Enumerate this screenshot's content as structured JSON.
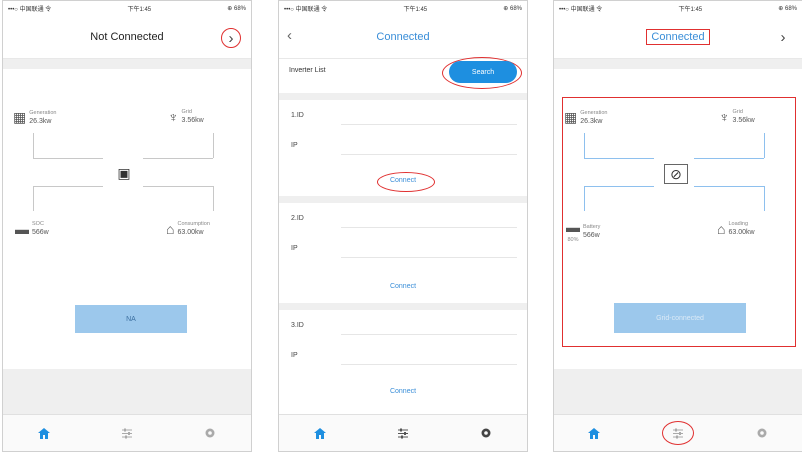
{
  "status_bar": {
    "left": "•••○ 中国联通 令",
    "time": "下午1:45",
    "right": "⊕ 68%"
  },
  "panel1": {
    "title": "Not Connected",
    "nodes": {
      "generation": {
        "label": "Generation",
        "value": "26.3kw"
      },
      "grid": {
        "label": "Grid",
        "value": "3.56kw"
      },
      "battery": {
        "label": "SOC",
        "value": "566w"
      },
      "consumption": {
        "label": "Consumption",
        "value": "63.00kw"
      }
    },
    "button_label": "NA"
  },
  "panel2": {
    "title": "Connected",
    "inverter_list_label": "Inverter List",
    "search_label": "Search",
    "inverters": [
      {
        "id_label": "1.ID",
        "ip_label": "IP",
        "connect_label": "Connect"
      },
      {
        "id_label": "2.ID",
        "ip_label": "IP",
        "connect_label": "Connect"
      },
      {
        "id_label": "3.ID",
        "ip_label": "IP",
        "connect_label": "Connect"
      }
    ]
  },
  "panel3": {
    "title": "Connected",
    "nodes": {
      "generation": {
        "label": "Generation",
        "value": "26.3kw"
      },
      "grid": {
        "label": "Grid",
        "value": "3.56kw"
      },
      "battery": {
        "label": "Battery",
        "soc": "80%",
        "value": "566w"
      },
      "loading": {
        "label": "Loading",
        "value": "63.00kw"
      }
    },
    "button_label": "Grid-connected"
  },
  "colors": {
    "accent": "#1e8fe0",
    "highlight": "#e03030",
    "button_fill": "#9cc8ec"
  },
  "icons": [
    "home-icon",
    "settings-sliders-icon",
    "gear-icon",
    "chevron-right-icon",
    "chevron-left-icon"
  ]
}
